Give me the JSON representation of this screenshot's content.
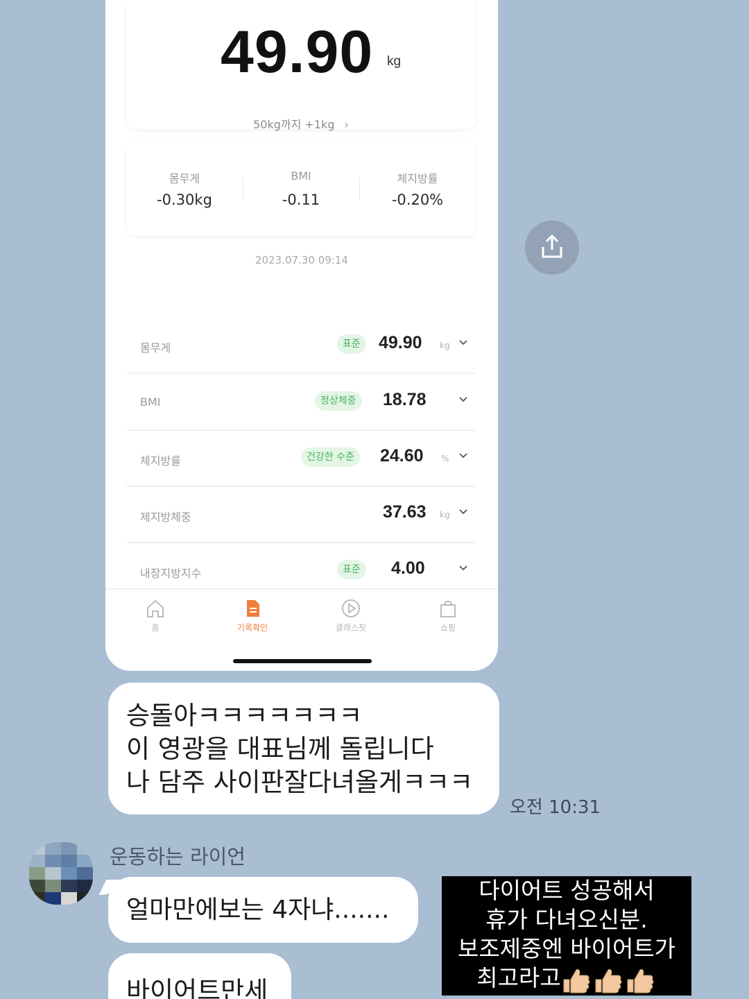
{
  "app": {
    "weight_value": "49.90",
    "weight_unit": "kg",
    "goal_text": "50kg까지 +1kg",
    "deltas": [
      {
        "label": "몸무게",
        "value": "-0.30kg"
      },
      {
        "label": "BMI",
        "value": "-0.11"
      },
      {
        "label": "체지방률",
        "value": "-0.20%"
      }
    ],
    "timestamp": "2023.07.30 09:14",
    "metrics": [
      {
        "label": "몸무게",
        "badge": "표준",
        "value": "49.90",
        "unit": "kg"
      },
      {
        "label": "BMI",
        "badge": "정상체중",
        "value": "18.78",
        "unit": ""
      },
      {
        "label": "체지방률",
        "badge": "건강한 수준",
        "value": "24.60",
        "unit": "%"
      },
      {
        "label": "제지방체중",
        "badge": "",
        "value": "37.63",
        "unit": "kg"
      },
      {
        "label": "내장지방지수",
        "badge": "표준",
        "value": "4.00",
        "unit": ""
      }
    ],
    "tabs": [
      {
        "label": "홈",
        "icon": "home-icon",
        "active": false
      },
      {
        "label": "기록확인",
        "icon": "document-icon",
        "active": true
      },
      {
        "label": "클래스핏",
        "icon": "play-icon",
        "active": false
      },
      {
        "label": "쇼핑",
        "icon": "shopping-bag-icon",
        "active": false
      }
    ],
    "colors": {
      "badge_green": "#47b25e",
      "badge_bg": "#e3f6e6",
      "active_tab": "#f07f3c"
    }
  },
  "chat": {
    "sent_message_lines": [
      "승돌아ㅋㅋㅋㅋㅋㅋㅋ",
      "이 영광을 대표님께 돌립니다",
      "나 담주 사이판잘다녀올게ㅋㅋㅋ"
    ],
    "sent_time": "오전 10:31",
    "sender_name": "운동하는 라이언",
    "received_messages": [
      "얼마만에보는 4자냐.......",
      "바이어트만세"
    ],
    "background_color": "#a9bdd3",
    "share_icon": "share-icon"
  },
  "caption": {
    "lines": [
      "다이어트 성공해서",
      "휴가 다녀오신분.",
      "보조제중엔 바이어트가",
      "최고라고"
    ],
    "emoji": "thumbs-up-icon"
  }
}
